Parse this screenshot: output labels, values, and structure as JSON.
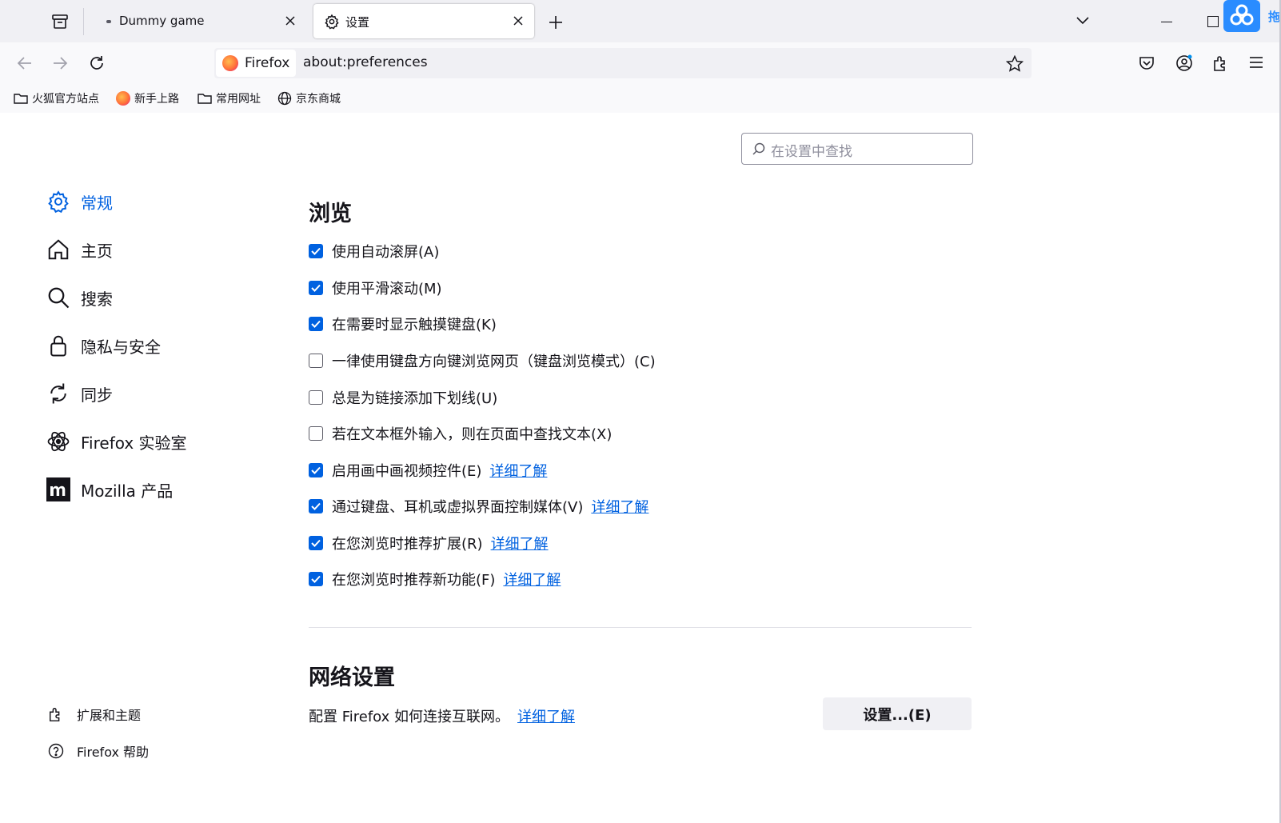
{
  "tabs": [
    {
      "title": "Dummy game",
      "active": false
    },
    {
      "title": "设置",
      "active": true
    }
  ],
  "toolbar": {
    "identity_label": "Firefox",
    "url": "about:preferences"
  },
  "bookmarks": [
    {
      "label": "火狐官方站点",
      "icon": "folder-icon"
    },
    {
      "label": "新手上路",
      "icon": "firefox-icon"
    },
    {
      "label": "常用网址",
      "icon": "folder-icon"
    },
    {
      "label": "京东商城",
      "icon": "globe-icon"
    }
  ],
  "search": {
    "placeholder": "在设置中查找"
  },
  "sidebar": {
    "categories": [
      {
        "label": "常规",
        "icon": "gear-icon",
        "selected": true
      },
      {
        "label": "主页",
        "icon": "home-icon",
        "selected": false
      },
      {
        "label": "搜索",
        "icon": "search-icon",
        "selected": false
      },
      {
        "label": "隐私与安全",
        "icon": "lock-icon",
        "selected": false
      },
      {
        "label": "同步",
        "icon": "sync-icon",
        "selected": false
      },
      {
        "label": "Firefox 实验室",
        "icon": "atom-icon",
        "selected": false
      },
      {
        "label": "Mozilla 产品",
        "icon": "mozilla-icon",
        "selected": false
      }
    ],
    "footer": [
      {
        "label": "扩展和主题",
        "icon": "puzzle-icon"
      },
      {
        "label": "Firefox 帮助",
        "icon": "help-icon"
      }
    ]
  },
  "browsing": {
    "title": "浏览",
    "options": [
      {
        "label": "使用自动滚屏(A)",
        "checked": true,
        "link": ""
      },
      {
        "label": "使用平滑滚动(M)",
        "checked": true,
        "link": ""
      },
      {
        "label": "在需要时显示触摸键盘(K)",
        "checked": true,
        "link": ""
      },
      {
        "label": "一律使用键盘方向键浏览网页（键盘浏览模式）(C)",
        "checked": false,
        "link": ""
      },
      {
        "label": "总是为链接添加下划线(U)",
        "checked": false,
        "link": ""
      },
      {
        "label": "若在文本框外输入，则在页面中查找文本(X)",
        "checked": false,
        "link": ""
      },
      {
        "label": "启用画中画视频控件(E)",
        "checked": true,
        "link": "详细了解"
      },
      {
        "label": "通过键盘、耳机或虚拟界面控制媒体(V)",
        "checked": true,
        "link": "详细了解"
      },
      {
        "label": "在您浏览时推荐扩展(R)",
        "checked": true,
        "link": "详细了解"
      },
      {
        "label": "在您浏览时推荐新功能(F)",
        "checked": true,
        "link": "详细了解"
      }
    ]
  },
  "network": {
    "title": "网络设置",
    "description": "配置 Firefox 如何连接互联网。",
    "link": "详细了解",
    "button": "设置...(E)"
  },
  "overlay": {
    "label": "拖"
  },
  "colors": {
    "accent": "#0061e0",
    "tabstrip": "#f0f0f4"
  }
}
